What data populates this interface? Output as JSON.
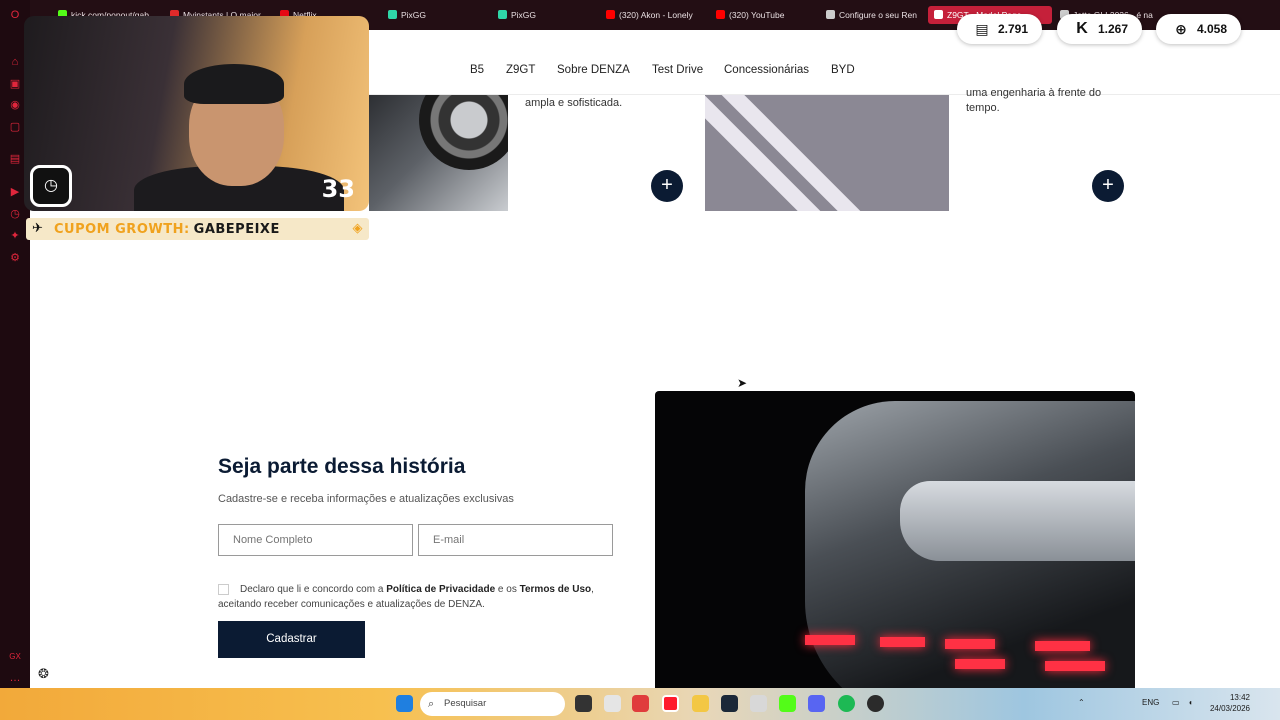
{
  "browser": {
    "tabs": [
      {
        "label": "kick.com/popout/gab",
        "color": "#53fc18"
      },
      {
        "label": "Myinstants | O maior",
        "color": "#e02a2a"
      },
      {
        "label": "Netflix",
        "color": "#e50914"
      },
      {
        "label": "PixGG",
        "color": "#2fd6a8"
      },
      {
        "label": "PixGG",
        "color": "#2fd6a8"
      },
      {
        "label": "(320) Akon - Lonely",
        "color": "#ff0000"
      },
      {
        "label": "(320) YouTube",
        "color": "#ff0000"
      },
      {
        "label": "Configure o seu Ren",
        "color": "#cccccc"
      },
      {
        "label": "Z9GT - Model Page",
        "color": "#ffffff"
      },
      {
        "label": "Jetta GLI 2026 - é na",
        "color": "#cccccc"
      }
    ]
  },
  "stats": [
    {
      "icon": "twitch-icon",
      "value": "2.791"
    },
    {
      "icon": "kick-icon",
      "value": "1.267"
    },
    {
      "icon": "globe-icon",
      "value": "4.058"
    }
  ],
  "nav": {
    "items": [
      "B5",
      "Z9GT",
      "Sobre DENZA",
      "Test Drive",
      "Concessionárias",
      "BYD"
    ]
  },
  "cards": {
    "blurb_left": "ampla e sofisticada.",
    "blurb_right_1": "uma engenharia à frente do",
    "blurb_right_2": "tempo.",
    "plus_symbol": "+"
  },
  "overlay": {
    "counter": "33",
    "coupon_label": "CUPOM GROWTH:",
    "coupon_code": "GABEPEIXE"
  },
  "signup": {
    "title": "Seja parte dessa história",
    "subtitle": "Cadastre-se e receba informações e atualizações exclusivas",
    "name_placeholder": "Nome Completo",
    "email_placeholder": "E-mail",
    "consent_prefix": "Declaro que li e concordo com a",
    "privacy_link": "Política de Privacidade",
    "consent_and": "e os",
    "terms_link": "Termos de Uso",
    "consent_suffix": ", aceitando receber comunicações e atualizações de DENZA.",
    "submit_label": "Cadastrar"
  },
  "taskbar": {
    "search_placeholder": "Pesquisar",
    "language": "ENG",
    "time": "13:42",
    "date": "24/03/2026"
  }
}
